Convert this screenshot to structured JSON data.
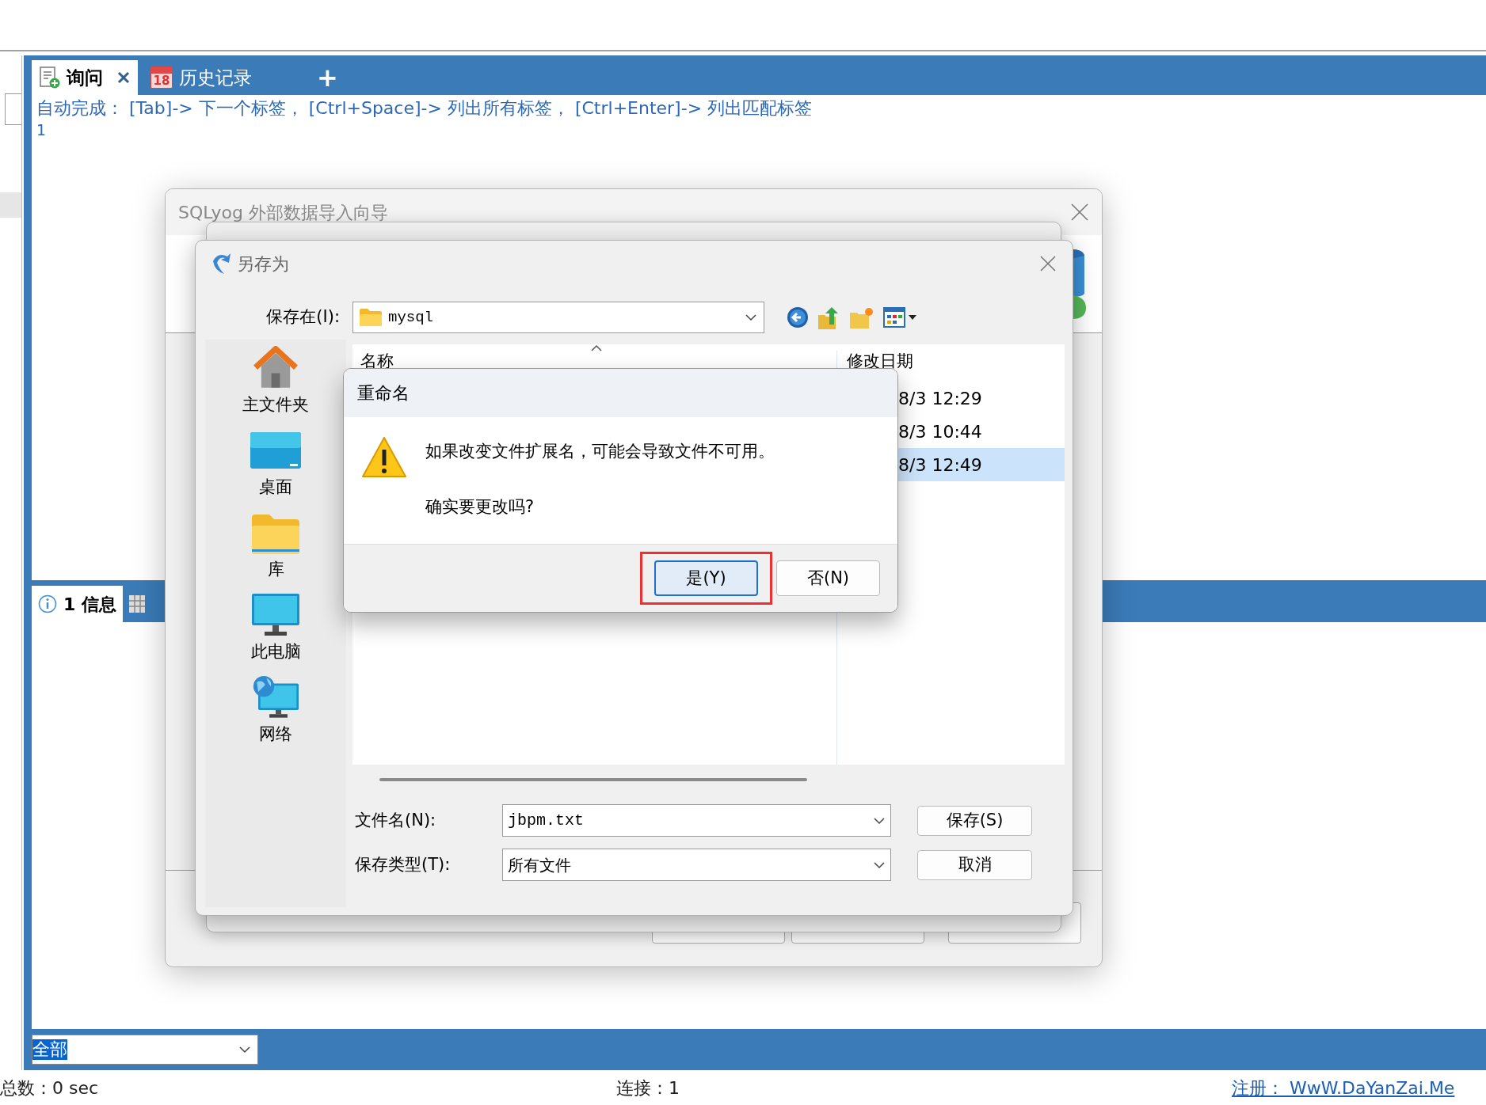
{
  "editor_tabs": [
    {
      "label": "询问",
      "selected": true,
      "closable": true,
      "kind": "query"
    },
    {
      "label": "历史记录",
      "selected": false,
      "closable": false,
      "kind": "calendar",
      "icon_text": "18"
    }
  ],
  "new_tab_button": "+",
  "autocomplete_hint": "自动完成： [Tab]-> 下一个标签， [Ctrl+Space]-> 列出所有标签， [Ctrl+Enter]-> 列出匹配标签",
  "line_numbers": [
    "1"
  ],
  "result_tabs": [
    {
      "label": "1 信息",
      "selected": true
    }
  ],
  "filter_select": {
    "value": "全部"
  },
  "status_bar": {
    "total": "总数：0 sec",
    "connection": "连接：1",
    "register_link": "注册： WwW.DaYanZai.Me"
  },
  "wizard_window": {
    "title": "SQLyog 外部数据导入向导"
  },
  "save_as_dialog": {
    "title": "另存为",
    "save_in": {
      "label": "保存在(I):",
      "value": "mysql"
    },
    "places": [
      {
        "label": "主文件夹",
        "kind": "home"
      },
      {
        "label": "桌面",
        "kind": "desktop"
      },
      {
        "label": "库",
        "kind": "library"
      },
      {
        "label": "此电脑",
        "kind": "computer"
      },
      {
        "label": "网络",
        "kind": "network"
      }
    ],
    "columns": [
      "名称",
      "修改日期"
    ],
    "rows": [
      {
        "modified": "8/3 12:29",
        "selected": false
      },
      {
        "modified": "8/3 10:44",
        "selected": false
      },
      {
        "modified": "8/3 12:49",
        "selected": true
      }
    ],
    "file_name": {
      "label": "文件名(N):",
      "value": "jbpm.txt"
    },
    "file_type": {
      "label": "保存类型(T):",
      "value": "所有文件"
    },
    "buttons": [
      "保存(S)",
      "取消"
    ]
  },
  "rename_dialog": {
    "title": "重命名",
    "message": "如果改变文件扩展名，可能会导致文件不可用。",
    "question": "确实要更改吗?",
    "buttons": [
      {
        "label": "是(Y)",
        "default": true,
        "highlighted": true
      },
      {
        "label": "否(N)",
        "default": false,
        "highlighted": false
      }
    ]
  }
}
